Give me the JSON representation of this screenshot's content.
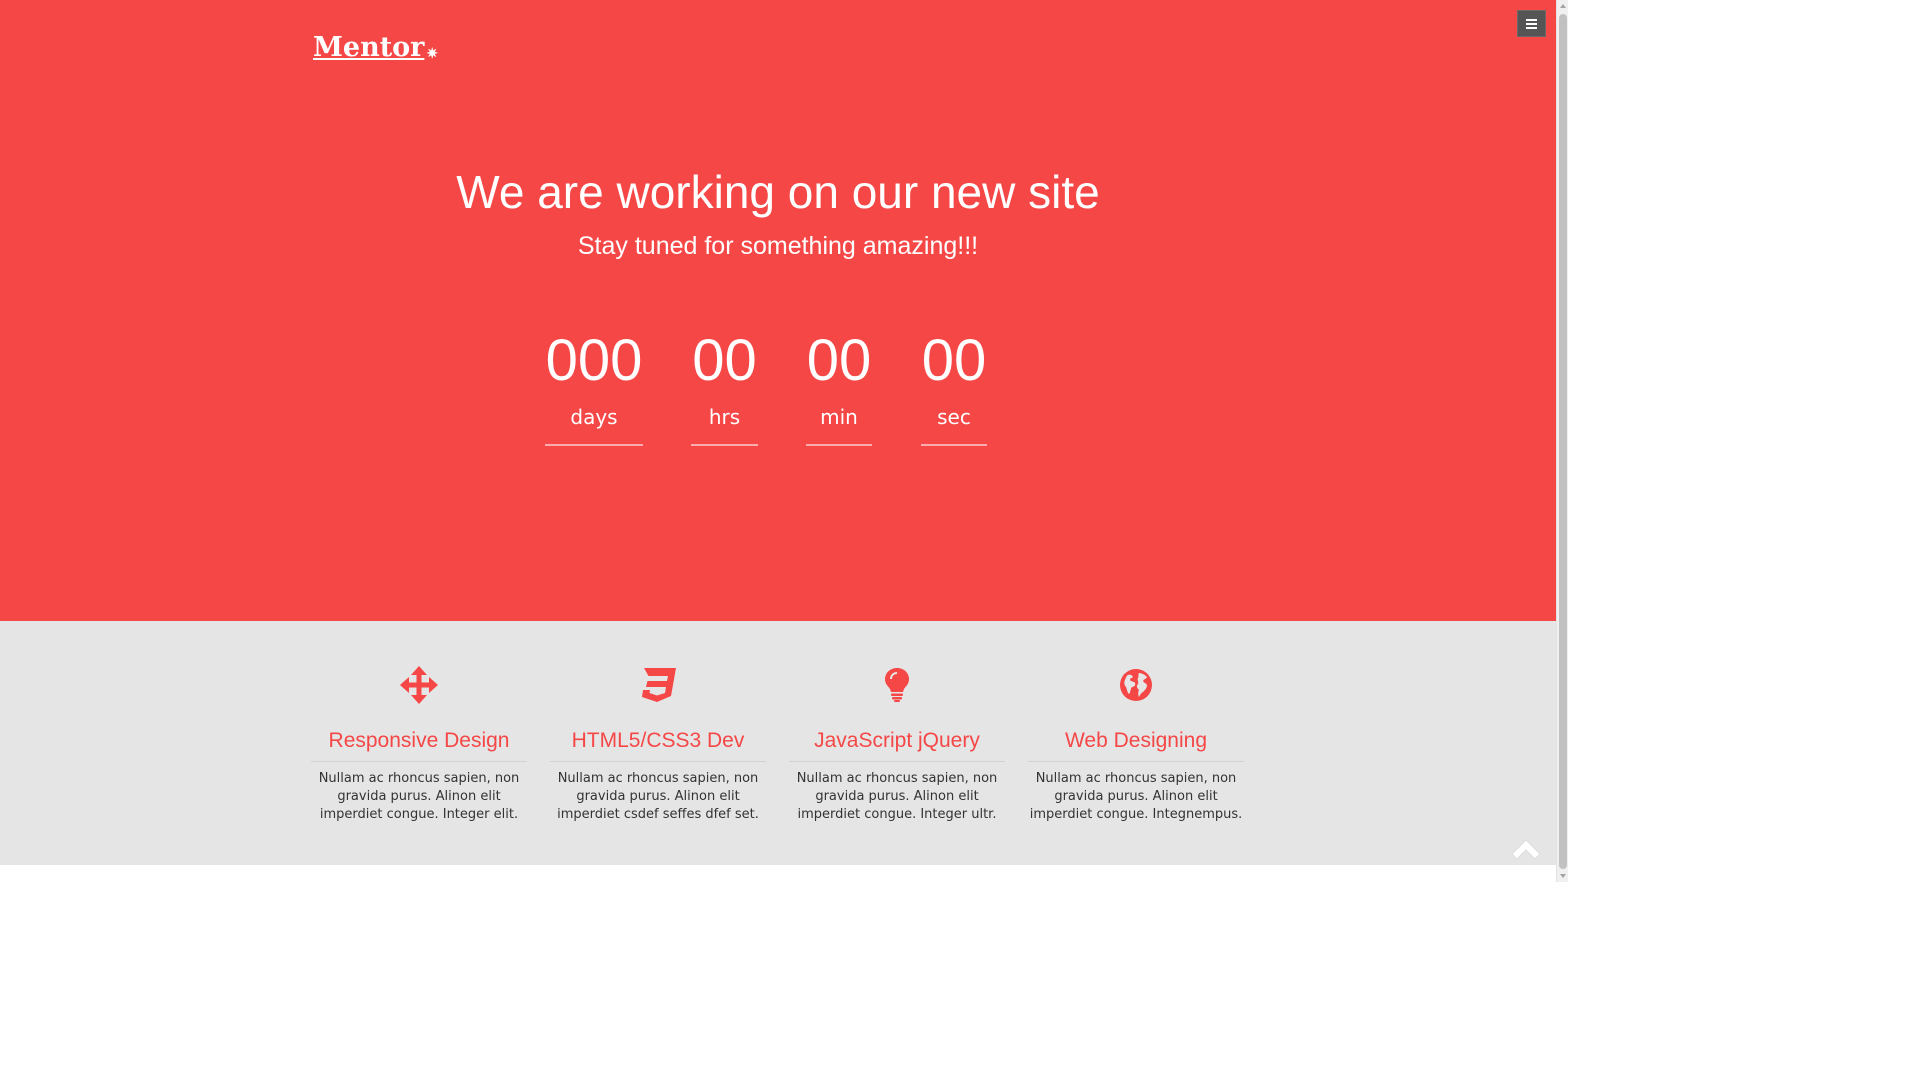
{
  "brand": {
    "logo_text": "Mentor",
    "logo_mark": "✷"
  },
  "nav": {
    "menu_icon": "hamburger-icon"
  },
  "hero": {
    "headline": "We are working on our new site",
    "subline": "Stay tuned for something amazing!!!",
    "background": "#f64747"
  },
  "countdown": [
    {
      "value": "000",
      "label": "days"
    },
    {
      "value": "00",
      "label": "hrs"
    },
    {
      "value": "00",
      "label": "min"
    },
    {
      "value": "00",
      "label": "sec"
    }
  ],
  "features": [
    {
      "icon": "move-arrows-icon",
      "title": "Responsive Design",
      "text": "Nullam ac rhoncus sapien, non gravida purus. Alinon elit imperdiet congue. Integer elit."
    },
    {
      "icon": "css3-icon",
      "title": "HTML5/CSS3 Dev",
      "text": "Nullam ac rhoncus sapien, non gravida purus. Alinon elit imperdiet csdef seffes dfef set."
    },
    {
      "icon": "lightbulb-icon",
      "title": "JavaScript jQuery",
      "text": "Nullam ac rhoncus sapien, non gravida purus. Alinon elit imperdiet congue. Integer ultr."
    },
    {
      "icon": "globe-icon",
      "title": "Web Designing",
      "text": "Nullam ac rhoncus sapien, non gravida purus. Alinon elit imperdiet congue. Integnempus."
    }
  ],
  "colors": {
    "accent": "#f64747",
    "features_bg": "#e5e5e5",
    "menu_button": "#555555"
  },
  "scroll_top_icon": "chevron-up-icon"
}
